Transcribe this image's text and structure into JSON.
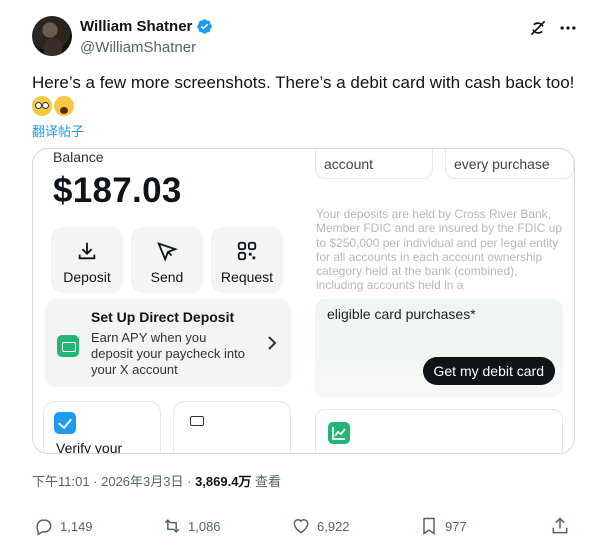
{
  "author": {
    "name": "William Shatner",
    "handle": "@WilliamShatner"
  },
  "icons": {
    "verified": "verified-badge-icon",
    "grok": "grok-icon",
    "more": "more-icon"
  },
  "tweet": {
    "text": "Here’s a few more screenshots. There’s a debit card with cash back too!",
    "emojis": [
      "flushed-face",
      "screaming-face"
    ],
    "translate_label": "翻译帖子"
  },
  "media": {
    "left": {
      "balance_label": "Balance",
      "balance_value": "$187.03",
      "actions": [
        {
          "label": "Deposit",
          "icon": "download-icon"
        },
        {
          "label": "Send",
          "icon": "send-icon"
        },
        {
          "label": "Request",
          "icon": "qr-code-icon"
        }
      ],
      "direct_deposit": {
        "title": "Set Up Direct Deposit",
        "description": "Earn APY when you deposit your paycheck into your X account"
      },
      "verify_label": "Verify your"
    },
    "right": {
      "tiles": [
        "account",
        "every purchase"
      ],
      "fdic_text": "Your deposits are held by Cross River Bank, Member FDIC and are insured by the FDIC up to $250,000 per individual and per legal entity for all accounts in each account ownership category held at the bank (combined), including accounts held in a",
      "debit_text": "eligible card purchases*",
      "debit_button": "Get my debit card"
    }
  },
  "meta": {
    "timestamp": "下午11:01 · 2026年3月3日 · ",
    "views": "3,869.4万",
    "views_label": " 查看"
  },
  "actions": {
    "replies": "1,149",
    "reposts": "1,086",
    "likes": "6,922",
    "bookmarks": "977"
  },
  "colors": {
    "accent": "#1d9bf0",
    "green": "#22b573",
    "text": "#0f1419",
    "muted": "#536471"
  }
}
